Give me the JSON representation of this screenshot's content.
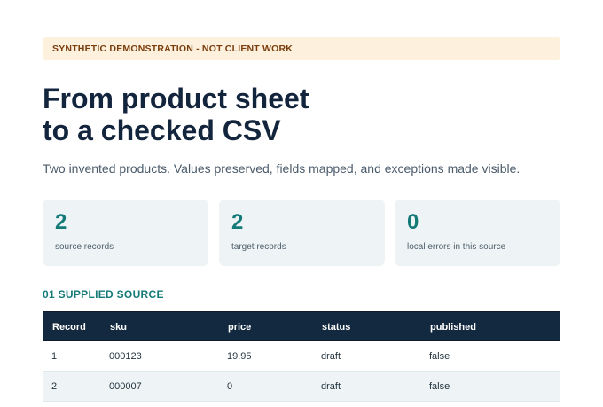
{
  "banner": "SYNTHETIC DEMONSTRATION - NOT CLIENT WORK",
  "title": {
    "line1": "From product sheet",
    "line2": "to a checked CSV"
  },
  "subtitle": "Two invented products. Values preserved, fields mapped, and exceptions made visible.",
  "stats": [
    {
      "value": "2",
      "label": "source records"
    },
    {
      "value": "2",
      "label": "target records"
    },
    {
      "value": "0",
      "label": "local errors in this source"
    }
  ],
  "section": {
    "heading": "01 SUPPLIED SOURCE"
  },
  "table": {
    "columns": [
      "Record",
      "sku",
      "price",
      "status",
      "published"
    ],
    "rows": [
      [
        "1",
        "000123",
        "19.95",
        "draft",
        "false"
      ],
      [
        "2",
        "000007",
        "0",
        "draft",
        "false"
      ]
    ]
  },
  "colors": {
    "accent": "#147a78",
    "header_bg": "#13293f",
    "banner_bg": "#fdf0dc",
    "card_bg": "#eef4f5"
  }
}
